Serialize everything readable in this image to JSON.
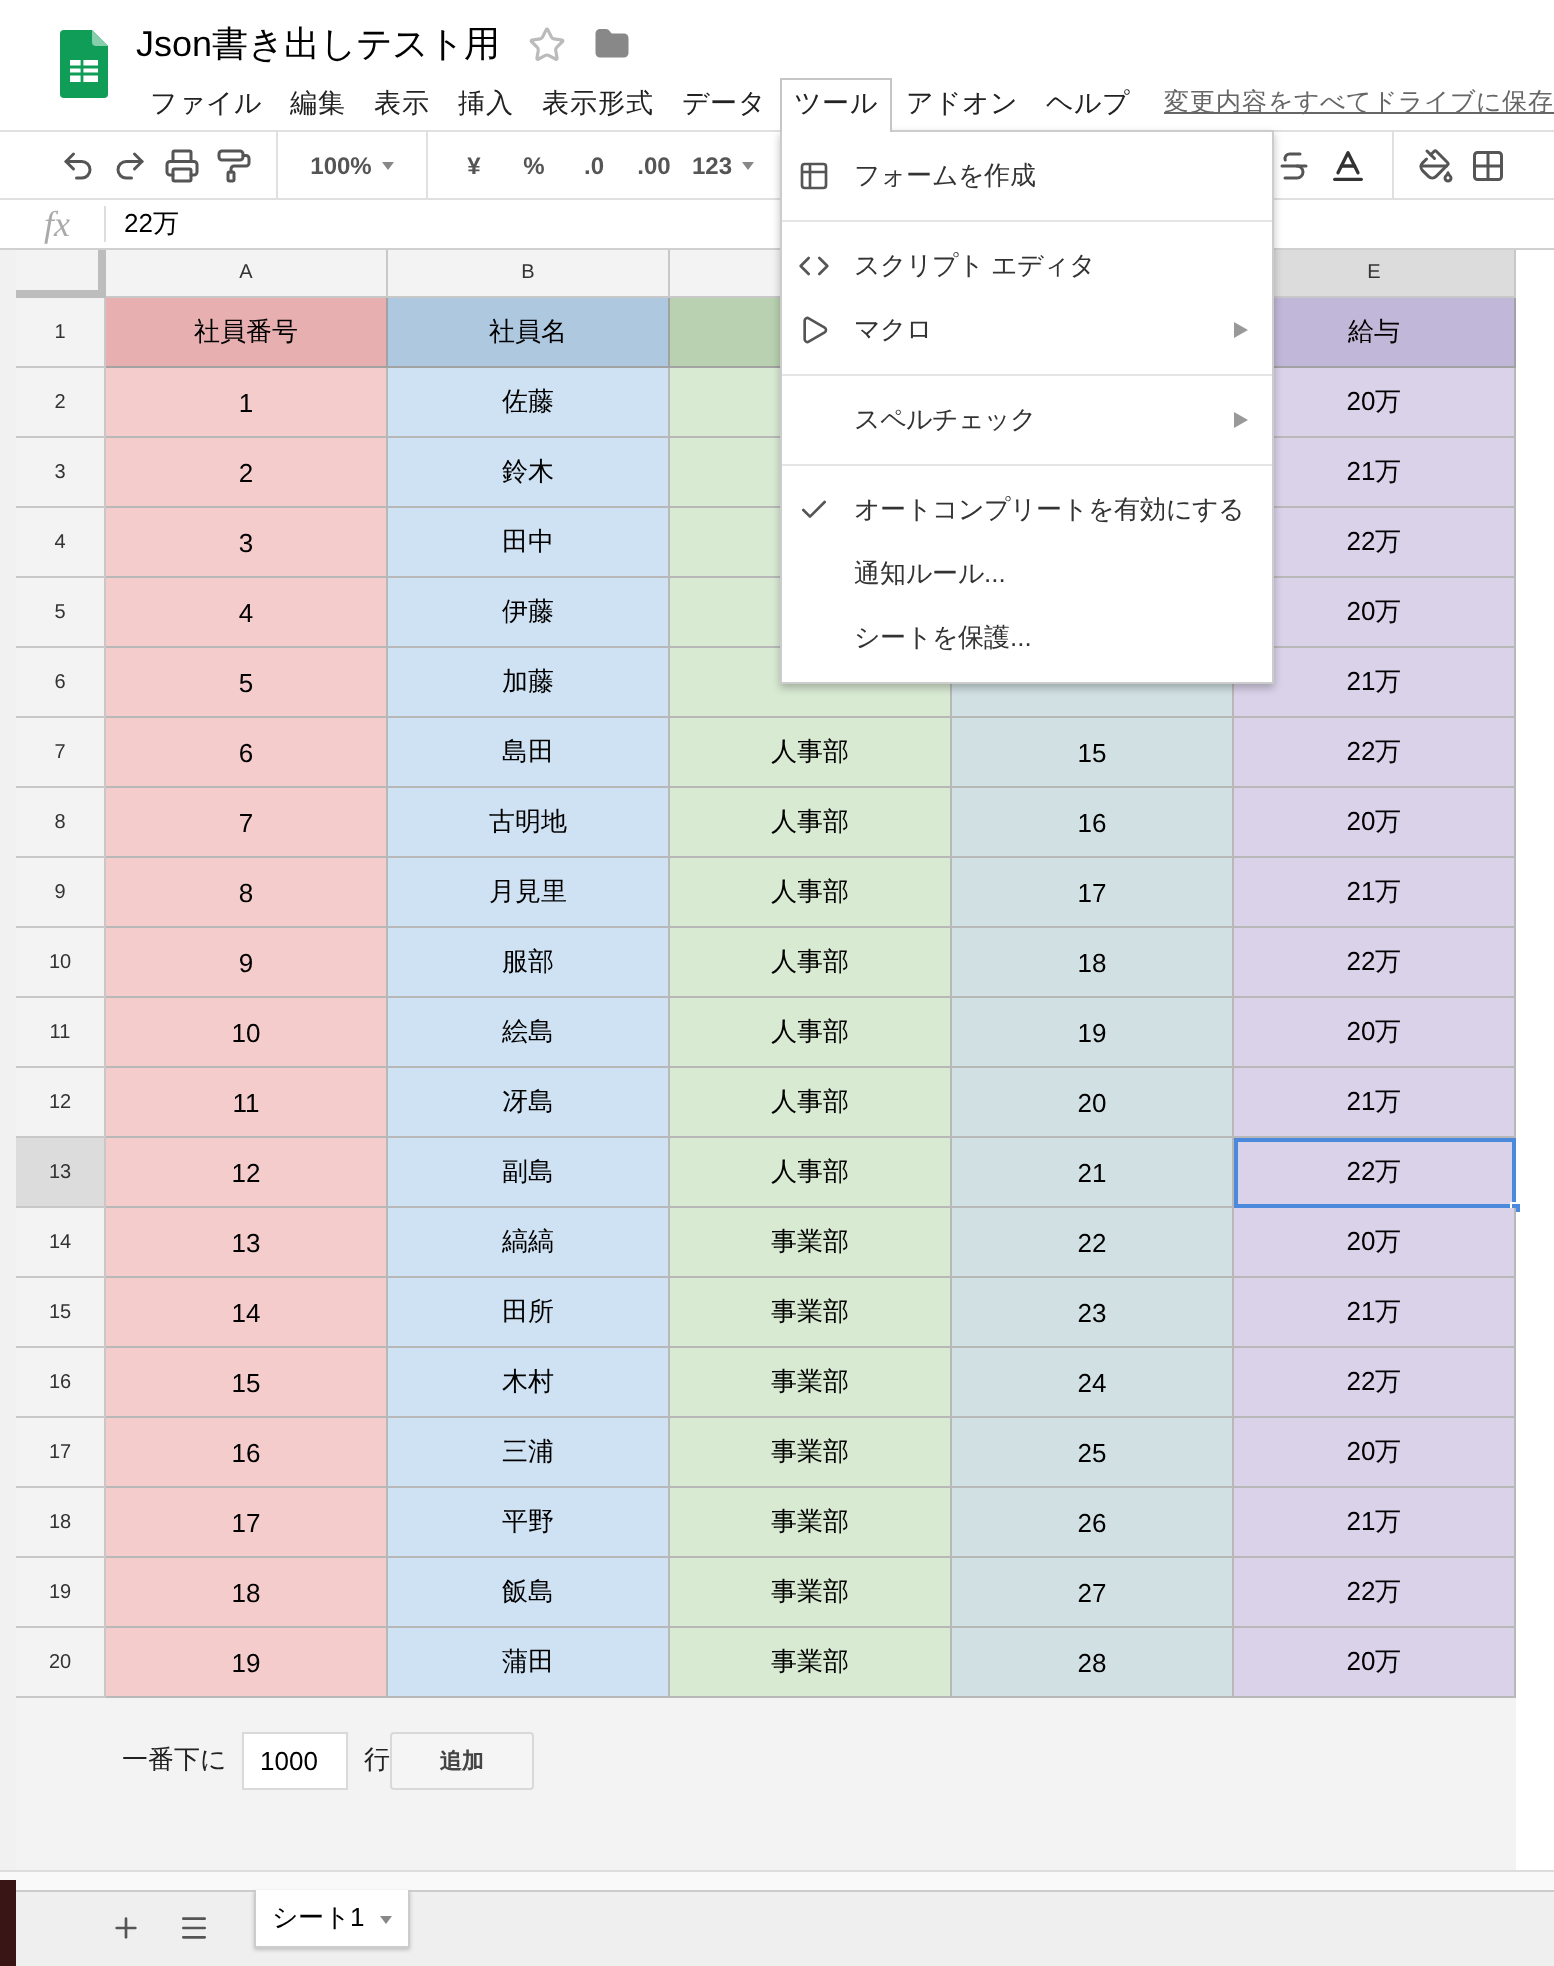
{
  "document": {
    "title": "Json書き出しテスト用",
    "starred": false
  },
  "menu_bar": [
    {
      "label": "ファイル",
      "selected": false
    },
    {
      "label": "編集",
      "selected": false
    },
    {
      "label": "表示",
      "selected": false
    },
    {
      "label": "挿入",
      "selected": false
    },
    {
      "label": "表示形式",
      "selected": false
    },
    {
      "label": "データ",
      "selected": false
    },
    {
      "label": "ツール",
      "selected": true
    },
    {
      "label": "アドオン",
      "selected": false
    },
    {
      "label": "ヘルプ",
      "selected": false
    }
  ],
  "save_link": "変更内容をすべてドライブに保存",
  "toolbar": {
    "zoom": "100%",
    "currency": "¥",
    "percent": "%",
    "decrease_decimals": ".0",
    "increase_decimals": ".00",
    "number_format": "123"
  },
  "formula_bar": {
    "label": "fx",
    "value": "22万"
  },
  "columns": [
    {
      "label": "A",
      "color": "#f4cccc",
      "selected": false
    },
    {
      "label": "B",
      "color": "#cfe2f3",
      "selected": false
    },
    {
      "color": "#d9ead3",
      "selected": false
    },
    {
      "color": "#d0e0e3",
      "selected": false
    },
    {
      "label": "E",
      "color": "#d9d2e9",
      "selected": true
    }
  ],
  "rows": [
    {
      "number": "1",
      "kind": "header",
      "selected": false,
      "cells": [
        "社員番号",
        "社員名",
        null,
        null,
        "給与"
      ]
    },
    {
      "number": "2",
      "kind": "data",
      "selected": false,
      "cells": [
        "1",
        "佐藤",
        null,
        null,
        "20万"
      ]
    },
    {
      "number": "3",
      "kind": "data",
      "selected": false,
      "cells": [
        "2",
        "鈴木",
        null,
        null,
        "21万"
      ]
    },
    {
      "number": "4",
      "kind": "data",
      "selected": false,
      "cells": [
        "3",
        "田中",
        null,
        null,
        "22万"
      ]
    },
    {
      "number": "5",
      "kind": "data",
      "selected": false,
      "cells": [
        "4",
        "伊藤",
        null,
        null,
        "20万"
      ]
    },
    {
      "number": "6",
      "kind": "data",
      "selected": false,
      "cells": [
        "5",
        "加藤",
        null,
        null,
        "21万"
      ]
    },
    {
      "number": "7",
      "kind": "data",
      "selected": false,
      "cells": [
        "6",
        "島田",
        "人事部",
        "15",
        "22万"
      ]
    },
    {
      "number": "8",
      "kind": "data",
      "selected": false,
      "cells": [
        "7",
        "古明地",
        "人事部",
        "16",
        "20万"
      ]
    },
    {
      "number": "9",
      "kind": "data",
      "selected": false,
      "cells": [
        "8",
        "月見里",
        "人事部",
        "17",
        "21万"
      ]
    },
    {
      "number": "10",
      "kind": "data",
      "selected": false,
      "cells": [
        "9",
        "服部",
        "人事部",
        "18",
        "22万"
      ]
    },
    {
      "number": "11",
      "kind": "data",
      "selected": false,
      "cells": [
        "10",
        "絵島",
        "人事部",
        "19",
        "20万"
      ]
    },
    {
      "number": "12",
      "kind": "data",
      "selected": false,
      "cells": [
        "11",
        "冴島",
        "人事部",
        "20",
        "21万"
      ]
    },
    {
      "number": "13",
      "kind": "data",
      "selected": true,
      "cells": [
        "12",
        "副島",
        "人事部",
        "21",
        "22万"
      ]
    },
    {
      "number": "14",
      "kind": "data",
      "selected": false,
      "cells": [
        "13",
        "縞縞",
        "事業部",
        "22",
        "20万"
      ]
    },
    {
      "number": "15",
      "kind": "data",
      "selected": false,
      "cells": [
        "14",
        "田所",
        "事業部",
        "23",
        "21万"
      ]
    },
    {
      "number": "16",
      "kind": "data",
      "selected": false,
      "cells": [
        "15",
        "木村",
        "事業部",
        "24",
        "22万"
      ]
    },
    {
      "number": "17",
      "kind": "data",
      "selected": false,
      "cells": [
        "16",
        "三浦",
        "事業部",
        "25",
        "20万"
      ]
    },
    {
      "number": "18",
      "kind": "data",
      "selected": false,
      "cells": [
        "17",
        "平野",
        "事業部",
        "26",
        "21万"
      ]
    },
    {
      "number": "19",
      "kind": "data",
      "selected": false,
      "cells": [
        "18",
        "飯島",
        "事業部",
        "27",
        "22万"
      ]
    },
    {
      "number": "20",
      "kind": "data",
      "selected": false,
      "cells": [
        "19",
        "蒲田",
        "事業部",
        "28",
        "20万"
      ]
    }
  ],
  "add_rows": {
    "prefix": "一番下に",
    "value": "1000",
    "suffix": "行",
    "button": "追加"
  },
  "tools_menu": {
    "groups": [
      [
        {
          "label": "フォームを作成",
          "kind": "form",
          "submenu": false,
          "checked": false
        }
      ],
      [
        {
          "label": "スクリプト エディタ",
          "kind": "code",
          "submenu": false,
          "checked": false
        },
        {
          "label": "マクロ",
          "kind": "macro",
          "submenu": true,
          "checked": false
        }
      ],
      [
        {
          "label": "スペルチェック",
          "kind": "plain",
          "submenu": true,
          "checked": false
        }
      ],
      [
        {
          "label": "オートコンプリートを有効にする",
          "kind": "plain",
          "submenu": false,
          "checked": true
        },
        {
          "label": "通知ルール...",
          "kind": "plain",
          "submenu": false,
          "checked": false
        },
        {
          "label": "シートを保護...",
          "kind": "plain",
          "submenu": false,
          "checked": false
        }
      ]
    ]
  },
  "sheet_tabs": [
    {
      "label": "シート1",
      "selected": true
    }
  ]
}
